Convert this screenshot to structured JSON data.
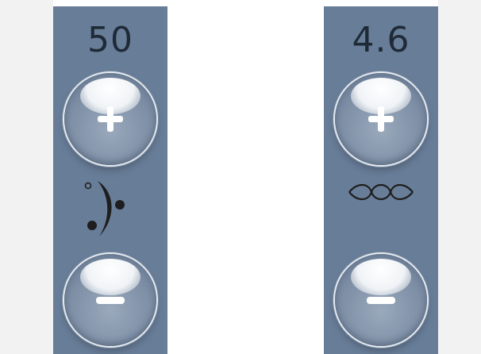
{
  "left_control": {
    "value": "50",
    "indicator_icon": "thread-tension-icon",
    "increase_icon": "plus-icon",
    "decrease_icon": "minus-icon"
  },
  "right_control": {
    "value": "4.6",
    "indicator_icon": "stitch-length-icon",
    "increase_icon": "plus-icon",
    "decrease_icon": "minus-icon"
  },
  "colors": {
    "panel": "#687d98",
    "background_gutter": "#f2f2f2",
    "value_text": "#1f2a37"
  }
}
